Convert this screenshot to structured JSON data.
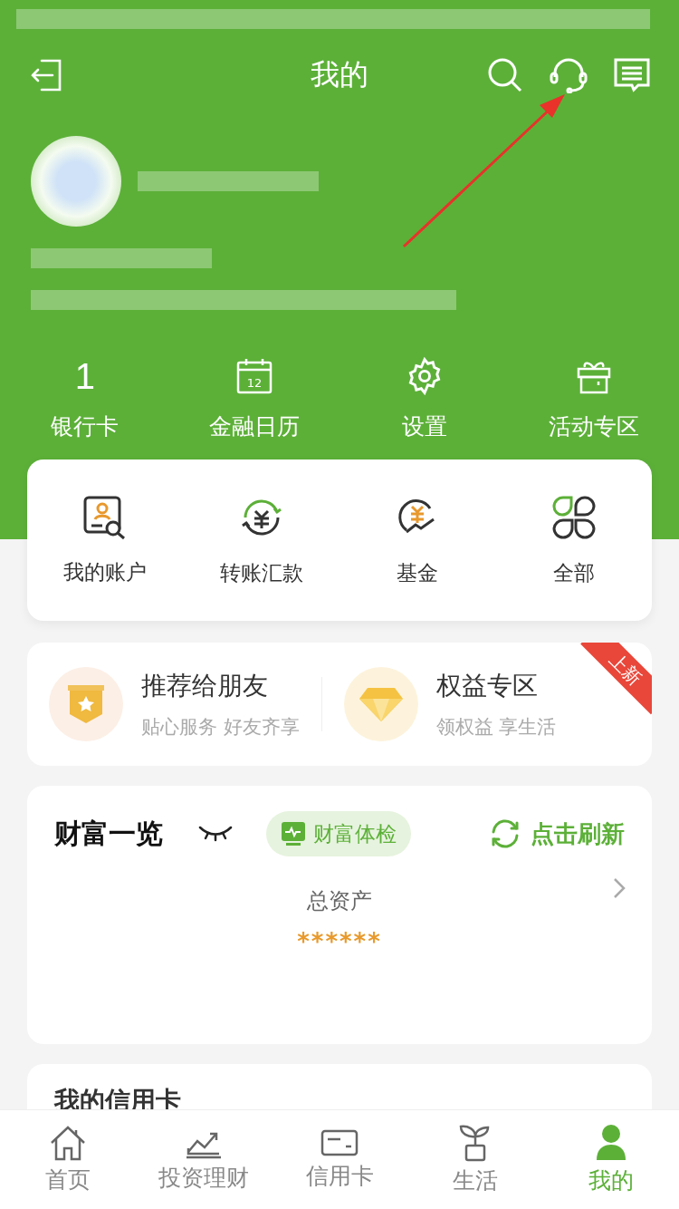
{
  "header": {
    "title": "我的"
  },
  "quick_links": [
    {
      "kind": "count",
      "value": "1",
      "label": "银行卡"
    },
    {
      "kind": "calendar",
      "day": "12",
      "label": "金融日历"
    },
    {
      "kind": "settings",
      "label": "设置"
    },
    {
      "kind": "gift",
      "label": "活动专区"
    }
  ],
  "shortcuts": [
    {
      "label": "我的账户"
    },
    {
      "label": "转账汇款"
    },
    {
      "label": "基金"
    },
    {
      "label": "全部"
    }
  ],
  "promos": [
    {
      "title": "推荐给朋友",
      "subtitle": "贴心服务 好友齐享"
    },
    {
      "title": "权益专区",
      "subtitle": "领权益 享生活",
      "badge": "上新"
    }
  ],
  "wealth": {
    "title": "财富一览",
    "check_button": "财富体检",
    "refresh_button": "点击刷新",
    "total_label": "总资产",
    "total_value": "******"
  },
  "credit_card": {
    "title": "我的信用卡"
  },
  "tabs": [
    {
      "label": "首页",
      "selected": false
    },
    {
      "label": "投资理财",
      "selected": false
    },
    {
      "label": "信用卡",
      "selected": false
    },
    {
      "label": "生活",
      "selected": false
    },
    {
      "label": "我的",
      "selected": true
    }
  ]
}
